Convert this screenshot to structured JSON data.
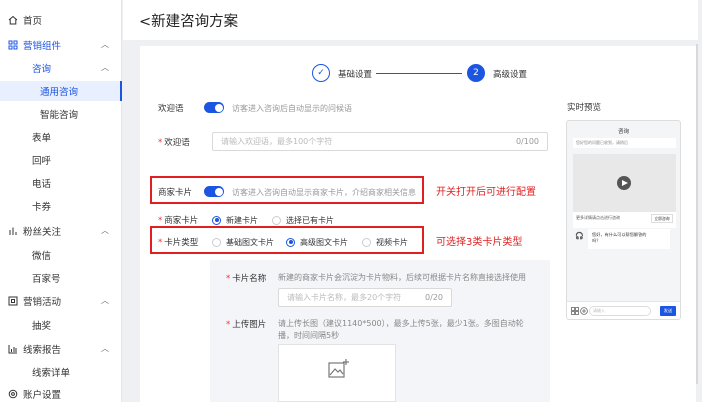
{
  "sidebar": {
    "items": [
      {
        "label": "首页",
        "icon": "home-icon"
      },
      {
        "label": "营销组件",
        "icon": "grid-icon"
      },
      {
        "label": "咨询"
      },
      {
        "label": "通用咨询"
      },
      {
        "label": "智能咨询"
      },
      {
        "label": "表单"
      },
      {
        "label": "回呼"
      },
      {
        "label": "电话"
      },
      {
        "label": "卡券"
      },
      {
        "label": "粉丝关注",
        "icon": "bar-chart-icon"
      },
      {
        "label": "微信"
      },
      {
        "label": "百家号"
      },
      {
        "label": "营销活动",
        "icon": "box-icon"
      },
      {
        "label": "抽奖"
      },
      {
        "label": "线索报告",
        "icon": "report-icon"
      },
      {
        "label": "线索详单"
      },
      {
        "label": "账户设置",
        "icon": "settings-icon"
      }
    ]
  },
  "header": {
    "title": "<新建咨询方案"
  },
  "steps": {
    "step1": {
      "num": "✓",
      "label": "基础设置"
    },
    "step2": {
      "num": "2",
      "label": "高级设置"
    }
  },
  "form": {
    "welcome_toggle_label": "欢迎语",
    "welcome_toggle_hint": "访客进入咨询后自动显示的问候语",
    "welcome_label": "欢迎语",
    "welcome_placeholder": "请输入欢迎语，最多100个字符",
    "welcome_count": "0/100",
    "card_toggle_label": "商家卡片",
    "card_toggle_hint": "访客进入咨询自动显示商家卡片，介绍商家相关信息",
    "card_label": "商家卡片",
    "card_options": [
      "新建卡片",
      "选择已有卡片"
    ],
    "card_type_label": "卡片类型",
    "card_type_options": [
      "基础图文卡片",
      "高级图文卡片",
      "视频卡片"
    ],
    "card_name_label": "卡片名称",
    "card_name_hint": "新建的商家卡片会沉淀为卡片物料，后续可根据卡片名称直接选择使用",
    "card_name_placeholder": "请输入卡片名称，最多20个字符",
    "card_name_count": "0/20",
    "upload_label": "上传图片",
    "upload_hint_1": "请上传长图（建议1140*500），最多上传5张，最少1张。多图自动轮",
    "upload_hint_2": "播，时间间隔5秒"
  },
  "annotations": {
    "a1": "开关打开后可进行配置",
    "a2": "可选择3类卡片类型"
  },
  "preview": {
    "title": "实时预览",
    "phone_title": "咨询",
    "welcome_text": "您好您的问题已收到，请稍后",
    "card_text": "更多详情请点击进行咨询",
    "card_button": "立即咨询",
    "msg_line1": "您好，有什么可以帮您解答的",
    "msg_line2": "吗？",
    "input_placeholder": "请输入",
    "send": "发送"
  },
  "colors": {
    "accent": "#1b55e2",
    "annotation": "#e02020"
  }
}
